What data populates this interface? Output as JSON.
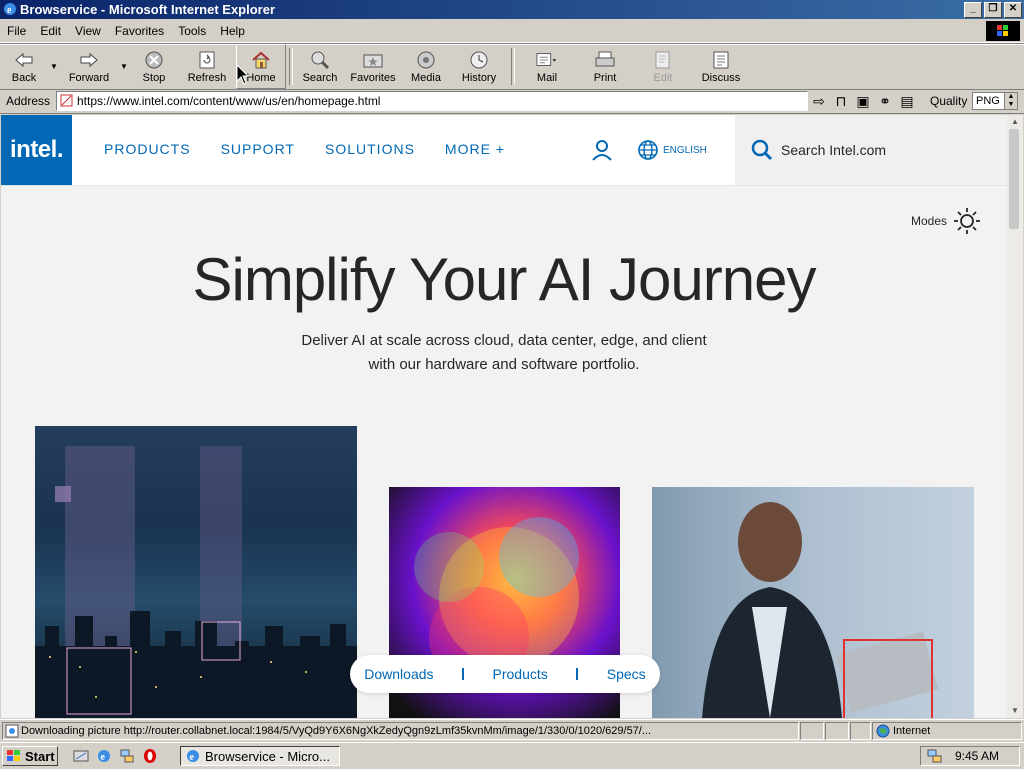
{
  "window": {
    "title": "Browservice - Microsoft Internet Explorer",
    "controls": [
      "_",
      "❐",
      "✕"
    ]
  },
  "menu": [
    "File",
    "Edit",
    "View",
    "Favorites",
    "Tools",
    "Help"
  ],
  "toolbar": {
    "back": "Back",
    "forward": "Forward",
    "stop": "Stop",
    "refresh": "Refresh",
    "home": "Home",
    "search": "Search",
    "favorites": "Favorites",
    "media": "Media",
    "history": "History",
    "mail": "Mail",
    "print": "Print",
    "edit": "Edit",
    "discuss": "Discuss"
  },
  "address": {
    "label": "Address",
    "url": "https://www.intel.com/content/www/us/en/homepage.html",
    "quality_label": "Quality",
    "quality_value": "PNG"
  },
  "site": {
    "logo": "intel.",
    "nav": [
      "PRODUCTS",
      "SUPPORT",
      "SOLUTIONS",
      "MORE +"
    ],
    "language": "ENGLISH",
    "search_placeholder": "Search Intel.com",
    "modes": "Modes",
    "hero_title": "Simplify Your AI Journey",
    "hero_sub_line1": "Deliver AI at scale across cloud, data center, edge, and client",
    "hero_sub_line2": "with our hardware and software portfolio.",
    "quick_links": [
      "Downloads",
      "Products",
      "Specs"
    ],
    "brand_color": "#0068b5"
  },
  "status": {
    "text": "Downloading picture http://router.collabnet.local:1984/5/VyQd9Y6X6NgXkZedyQgn9zLmf35kvnMm/image/1/330/0/1020/629/57/...",
    "zone": "Internet"
  },
  "taskbar": {
    "start": "Start",
    "task": "Browservice - Micro...",
    "clock": "9:45 AM"
  }
}
